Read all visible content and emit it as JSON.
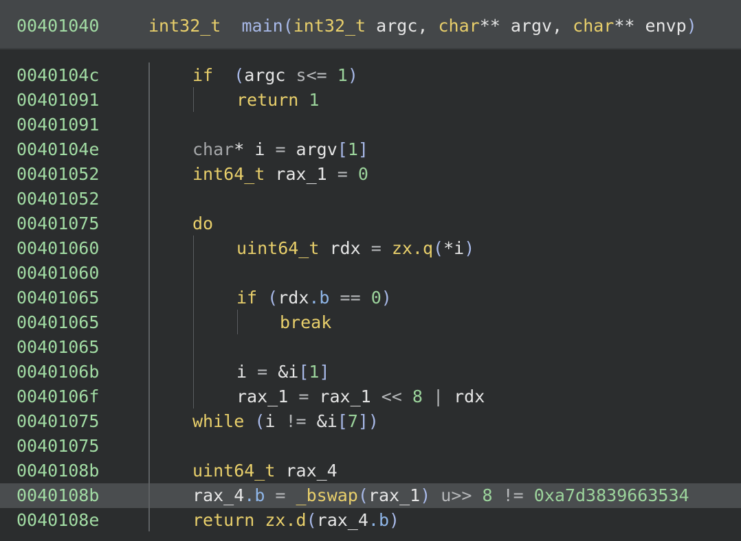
{
  "header": {
    "address": "00401040",
    "signature": {
      "ret_type": "int32_t",
      "name": "main",
      "open": "(",
      "p1_type": "int32_t",
      "p1_name": " argc, ",
      "p2_type": "char",
      "p2_rest": "** argv, ",
      "p3_type": "char",
      "p3_rest": "** envp",
      "close": ")"
    }
  },
  "lines": [
    {
      "addr": "0040104c",
      "indent": 1,
      "tokens": [
        [
          "kw",
          "if"
        ],
        [
          "",
          "  "
        ],
        [
          "paren",
          "("
        ],
        [
          "",
          "argc "
        ],
        [
          "op",
          "s<="
        ],
        [
          "cst",
          " 1"
        ],
        [
          "paren",
          ")"
        ]
      ]
    },
    {
      "addr": "00401091",
      "indent": 2,
      "tokens": [
        [
          "kw",
          "return"
        ],
        [
          "cst",
          " 1"
        ]
      ]
    },
    {
      "addr": "00401091",
      "indent": 0,
      "tokens": []
    },
    {
      "addr": "0040104e",
      "indent": 1,
      "tokens": [
        [
          "dim",
          "char"
        ],
        [
          "",
          "* i "
        ],
        [
          "op",
          "="
        ],
        [
          "",
          " argv"
        ],
        [
          "paren",
          "["
        ],
        [
          "cst",
          "1"
        ],
        [
          "paren",
          "]"
        ]
      ]
    },
    {
      "addr": "00401052",
      "indent": 1,
      "tokens": [
        [
          "kw",
          "int64_t"
        ],
        [
          "",
          " rax_1 "
        ],
        [
          "op",
          "="
        ],
        [
          "cst",
          " 0"
        ]
      ]
    },
    {
      "addr": "00401052",
      "indent": 0,
      "tokens": []
    },
    {
      "addr": "00401075",
      "indent": 1,
      "tokens": [
        [
          "kw",
          "do"
        ]
      ]
    },
    {
      "addr": "00401060",
      "indent": 2,
      "tokens": [
        [
          "kw",
          "uint64_t"
        ],
        [
          "",
          " rdx "
        ],
        [
          "op",
          "="
        ],
        [
          "",
          " "
        ],
        [
          "kw",
          "zx.q"
        ],
        [
          "paren",
          "("
        ],
        [
          "",
          "*i"
        ],
        [
          "paren",
          ")"
        ]
      ]
    },
    {
      "addr": "00401060",
      "indent": 0,
      "tokens": []
    },
    {
      "addr": "00401065",
      "indent": 2,
      "tokens": [
        [
          "kw",
          "if"
        ],
        [
          "paren",
          " ("
        ],
        [
          "",
          "rdx"
        ],
        [
          "fld",
          ".b"
        ],
        [
          "op",
          " =="
        ],
        [
          "cst",
          " 0"
        ],
        [
          "paren",
          ")"
        ]
      ]
    },
    {
      "addr": "00401065",
      "indent": 3,
      "tokens": [
        [
          "kw",
          "break"
        ]
      ]
    },
    {
      "addr": "00401065",
      "indent": 0,
      "tokens": []
    },
    {
      "addr": "0040106b",
      "indent": 2,
      "tokens": [
        [
          "",
          "i "
        ],
        [
          "op",
          "="
        ],
        [
          "",
          " &i"
        ],
        [
          "paren",
          "["
        ],
        [
          "cst",
          "1"
        ],
        [
          "paren",
          "]"
        ]
      ]
    },
    {
      "addr": "0040106f",
      "indent": 2,
      "tokens": [
        [
          "",
          "rax_1 "
        ],
        [
          "op",
          "="
        ],
        [
          "",
          " rax_1 "
        ],
        [
          "op",
          "<<"
        ],
        [
          "cst",
          " 8"
        ],
        [
          "op",
          " |"
        ],
        [
          "",
          " rdx"
        ]
      ]
    },
    {
      "addr": "00401075",
      "indent": 1,
      "tokens": [
        [
          "kw",
          "while"
        ],
        [
          "paren",
          " ("
        ],
        [
          "",
          "i "
        ],
        [
          "op",
          "!="
        ],
        [
          "",
          " &i"
        ],
        [
          "paren",
          "["
        ],
        [
          "cst",
          "7"
        ],
        [
          "paren",
          "])"
        ]
      ]
    },
    {
      "addr": "00401075",
      "indent": 0,
      "tokens": []
    },
    {
      "addr": "0040108b",
      "indent": 1,
      "tokens": [
        [
          "kw",
          "uint64_t"
        ],
        [
          "",
          " rax_4"
        ]
      ]
    },
    {
      "addr": "0040108b",
      "indent": 1,
      "highlight": true,
      "tokens": [
        [
          "",
          "rax_4"
        ],
        [
          "fld",
          ".b"
        ],
        [
          "op",
          " ="
        ],
        [
          "",
          " "
        ],
        [
          "bsw",
          "_bswap"
        ],
        [
          "paren",
          "("
        ],
        [
          "",
          "rax_1"
        ],
        [
          "paren",
          ")"
        ],
        [
          "op",
          " u>>"
        ],
        [
          "cst",
          " 8"
        ],
        [
          "op",
          " !="
        ],
        [
          "cst",
          " 0xa7d3839663534"
        ]
      ]
    },
    {
      "addr": "0040108e",
      "indent": 1,
      "tokens": [
        [
          "kw",
          "return"
        ],
        [
          "",
          " "
        ],
        [
          "kw",
          "zx.d"
        ],
        [
          "paren",
          "("
        ],
        [
          "",
          "rax_4"
        ],
        [
          "fld",
          ".b"
        ],
        [
          "paren",
          ")"
        ]
      ]
    }
  ],
  "colors": {
    "background": "#2b2d2e",
    "header_bg": "#444749",
    "highlight_bg": "#4a4d4f",
    "address": "#a2dca4",
    "keyword": "#e8cf6b",
    "constant": "#9cd49c"
  }
}
